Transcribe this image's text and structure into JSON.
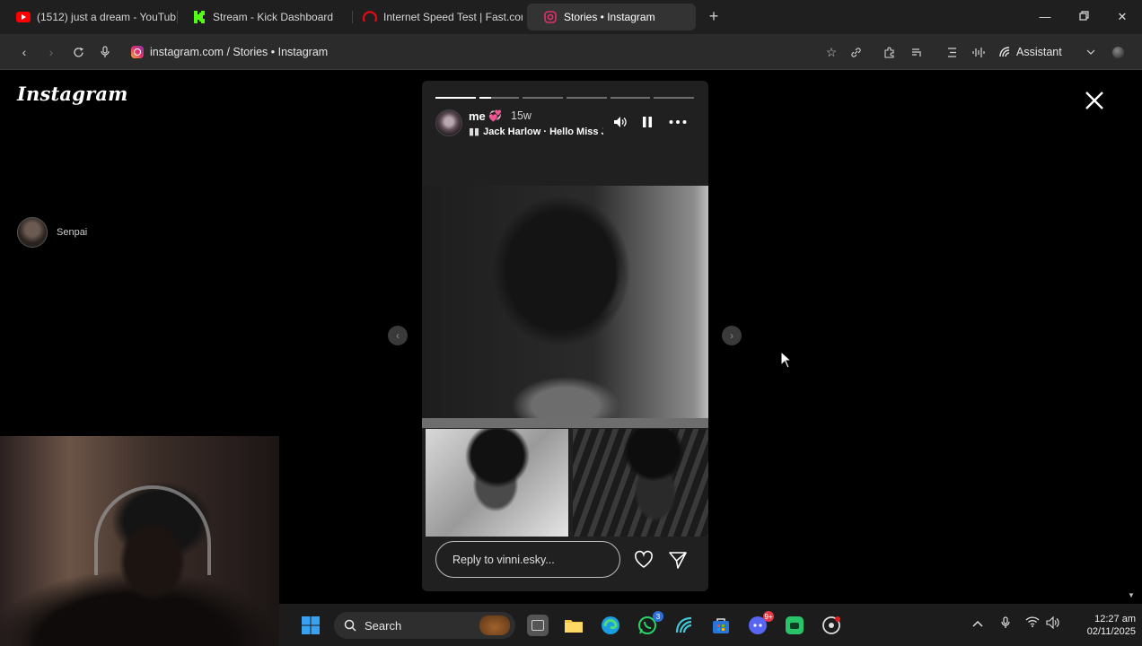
{
  "browser": {
    "tabs": [
      {
        "title": "(1512) just a dream - YouTube",
        "icon": "youtube-icon",
        "color": "#ff0000"
      },
      {
        "title": "Stream - Kick Dashboard",
        "icon": "kick-icon",
        "color": "#53fc18"
      },
      {
        "title": "Internet Speed Test | Fast.com",
        "icon": "fast-icon",
        "color": "#e50914"
      },
      {
        "title": "Stories • Instagram",
        "icon": "instagram-icon",
        "color": "#e1306c",
        "active": true
      }
    ],
    "url": "instagram.com / Stories • Instagram",
    "assistant_label": "Assistant"
  },
  "page": {
    "logo": "Instagram",
    "left_story_user": "Senpai"
  },
  "story": {
    "username": "me",
    "emoji": "💞",
    "time": "15w",
    "music": "Jack Harlow · Hello Miss Jc",
    "segments": [
      1,
      0.3,
      0,
      0,
      0,
      0
    ],
    "reply_placeholder": "Reply to vinni.esky..."
  },
  "taskbar": {
    "search_label": "Search",
    "whatsapp_badge": "3",
    "discord_badge": "9+",
    "time": "12:27 am",
    "date": "02/11/2025"
  }
}
